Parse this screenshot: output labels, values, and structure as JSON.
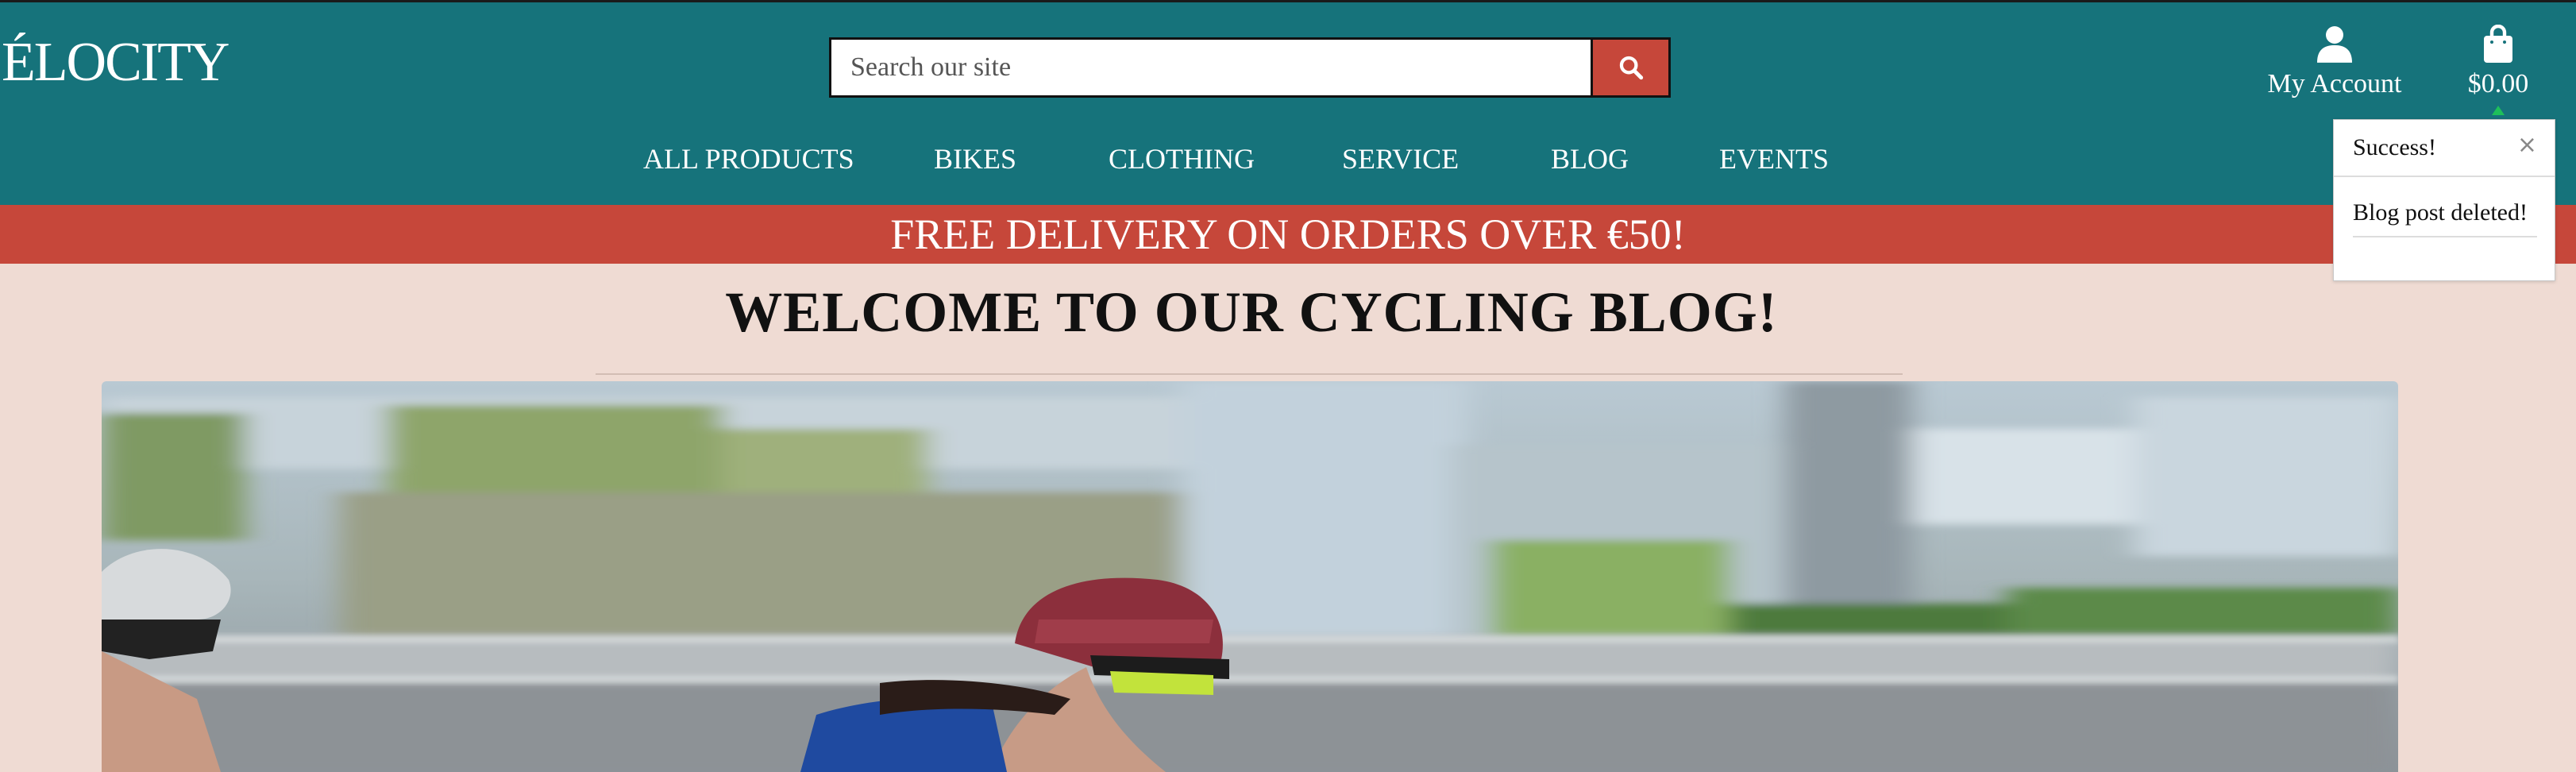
{
  "header": {
    "logo": "ÉLOCITY",
    "search": {
      "placeholder": "Search our site",
      "value": ""
    },
    "account_label": "My Account",
    "bag_total": "$0.00"
  },
  "nav": {
    "items": [
      {
        "label": "ALL PRODUCTS"
      },
      {
        "label": "BIKES"
      },
      {
        "label": "CLOTHING"
      },
      {
        "label": "SERVICE"
      },
      {
        "label": "BLOG"
      },
      {
        "label": "EVENTS"
      }
    ]
  },
  "banner": {
    "text": "FREE DELIVERY ON ORDERS OVER €50!"
  },
  "main": {
    "title": "WELCOME TO OUR CYCLING BLOG!"
  },
  "toast": {
    "title": "Success!",
    "close_glyph": "×",
    "message": "Blog post deleted!"
  },
  "icons": {
    "search": "search-icon",
    "account": "user-icon",
    "bag": "shopping-bag-icon"
  },
  "colors": {
    "header_bg": "#16737b",
    "accent_red": "#c6473a",
    "page_bg": "#efdbd3",
    "success_green": "#1ec05a"
  }
}
